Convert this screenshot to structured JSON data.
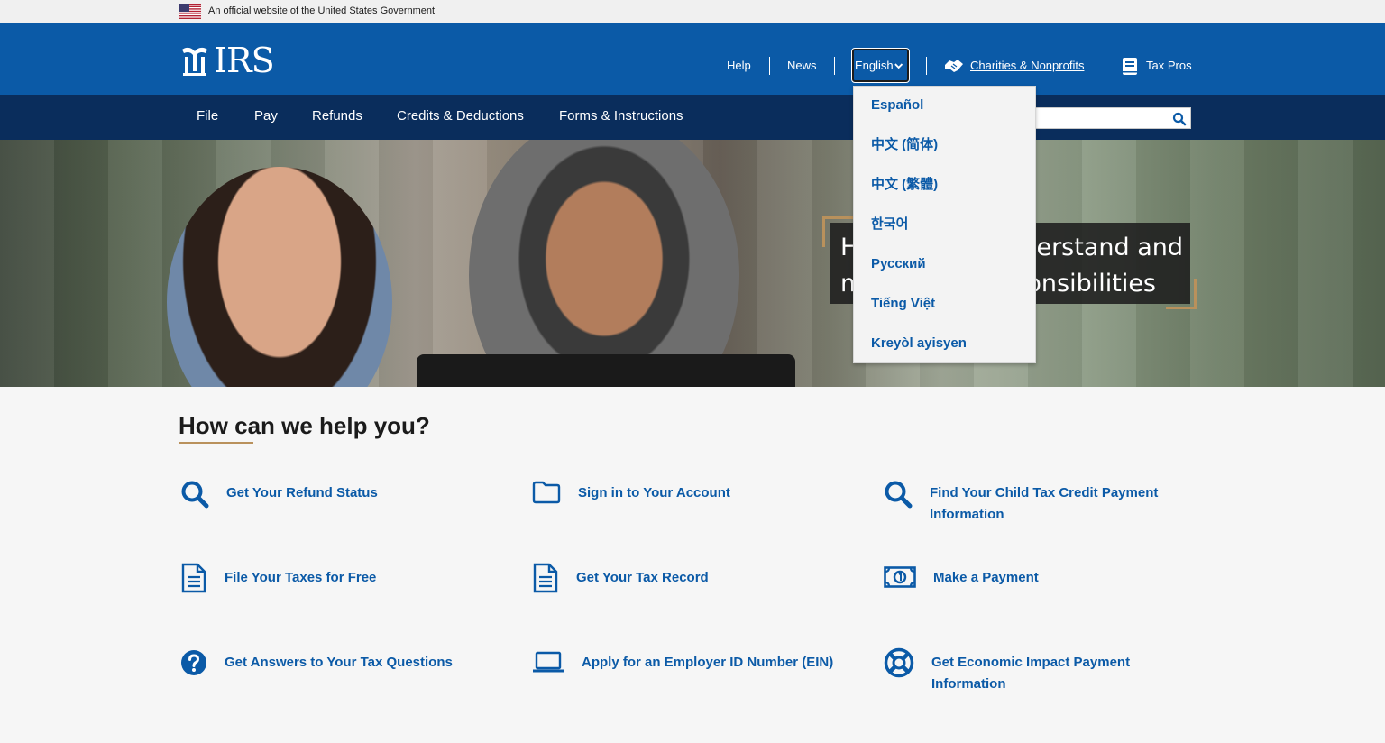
{
  "gov_banner": {
    "text": "An official website of the United States Government"
  },
  "header": {
    "logo_text": "IRS",
    "utility": {
      "help": "Help",
      "news": "News",
      "language_selected": "English",
      "charities": "Charities & Nonprofits",
      "tax_pros": "Tax Pros"
    }
  },
  "nav": {
    "items": [
      "File",
      "Pay",
      "Refunds",
      "Credits & Deductions",
      "Forms & Instructions"
    ]
  },
  "search": {
    "placeholder": ""
  },
  "hero": {
    "text": "Help us understand and meet your responsibilities",
    "visible_line1_left": "H",
    "visible_line1_right": "derstand and",
    "visible_line2_left": "m",
    "visible_line2_right": "onsibilities"
  },
  "language_dropdown": {
    "options": [
      "Español",
      "中文 (简体)",
      "中文 (繁體)",
      "한국어",
      "Русский",
      "Tiếng Việt",
      "Kreyòl ayisyen"
    ]
  },
  "help": {
    "title": "How can we help you?",
    "tasks": [
      {
        "label": "Get Your Refund Status",
        "icon": "search-icon"
      },
      {
        "label": "Sign in to Your Account",
        "icon": "folder-icon"
      },
      {
        "label": "Find Your Child Tax Credit Payment Information",
        "icon": "search-icon"
      },
      {
        "label": "File Your Taxes for Free",
        "icon": "document-icon"
      },
      {
        "label": "Get Your Tax Record",
        "icon": "document-icon"
      },
      {
        "label": "Make a Payment",
        "icon": "money-icon"
      },
      {
        "label": "Get Answers to Your Tax Questions",
        "icon": "question-icon"
      },
      {
        "label": "Apply for an Employer ID Number (EIN)",
        "icon": "laptop-icon"
      },
      {
        "label": "Get Economic Impact Payment Information",
        "icon": "lifebuoy-icon"
      }
    ]
  },
  "colors": {
    "header_blue": "#0b5aa7",
    "nav_navy": "#0a2d5c",
    "link_blue": "#0b5aa7",
    "accent_gold": "#b9915c"
  }
}
